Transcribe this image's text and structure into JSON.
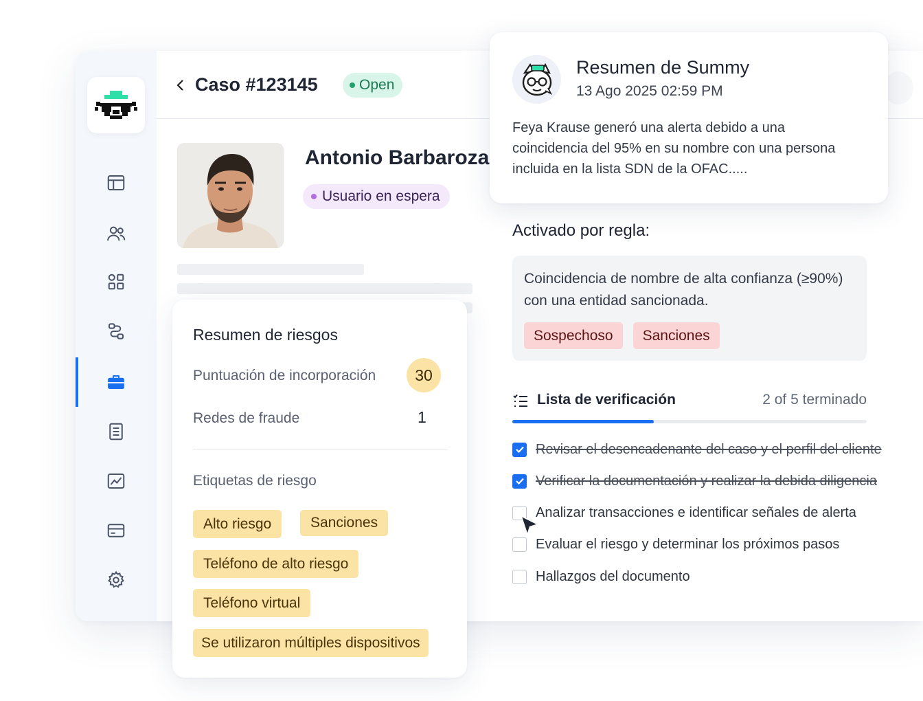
{
  "case": {
    "title": "Caso #123145",
    "status": "Open"
  },
  "user": {
    "name": "Antonio Barbaroza",
    "status": "Usuario en espera"
  },
  "sidebar": {
    "items": [
      {
        "icon": "layout-icon"
      },
      {
        "icon": "users-icon"
      },
      {
        "icon": "apps-grid-icon"
      },
      {
        "icon": "workflow-icon"
      },
      {
        "icon": "briefcase-icon",
        "active": true
      },
      {
        "icon": "document-icon"
      },
      {
        "icon": "chart-icon"
      },
      {
        "icon": "card-icon"
      },
      {
        "icon": "gear-icon"
      }
    ]
  },
  "summary": {
    "title": "Resumen de Summy",
    "date": "13 Ago 2025 02:59 PM",
    "text": "Feya Krause generó una alerta debido a una coincidencia del 95% en su nombre con una persona incluida en la lista SDN de la OFAC....."
  },
  "rule": {
    "heading": "Activado por regla:",
    "text": "Coincidencia de nombre de alta confianza (≥90%) con una entidad sancionada.",
    "tags": [
      "Sospechoso",
      "Sanciones"
    ]
  },
  "checklist": {
    "title": "Lista de verificación",
    "count": "2 of 5 terminado",
    "progress": 0.4,
    "items": [
      {
        "label": "Revisar el desencadenante del caso y el perfil del cliente",
        "done": true
      },
      {
        "label": "Verificar la documentación y realizar la debida diligencia",
        "done": true
      },
      {
        "label": "Analizar transacciones e identificar señales de alerta",
        "done": false
      },
      {
        "label": "Evaluar el riesgo y determinar los próximos pasos",
        "done": false
      },
      {
        "label": "Hallazgos del documento",
        "done": false
      }
    ]
  },
  "risk": {
    "title": "Resumen de riesgos",
    "score_label": "Puntuación de incorporación",
    "score": "30",
    "fraud_label": "Redes de fraude",
    "fraud_value": "1",
    "tags_label": "Etiquetas de riesgo",
    "tags": [
      "Alto riesgo",
      "Sanciones",
      "Teléfono de alto riesgo",
      "Teléfono virtual",
      "Se utilizaron múltiples dispositivos"
    ]
  },
  "colors": {
    "accent": "#1a6ff0",
    "open_badge": "#d9f5e9",
    "risk_tag": "#fbe3a6",
    "rule_tag": "#fbd5d5"
  }
}
